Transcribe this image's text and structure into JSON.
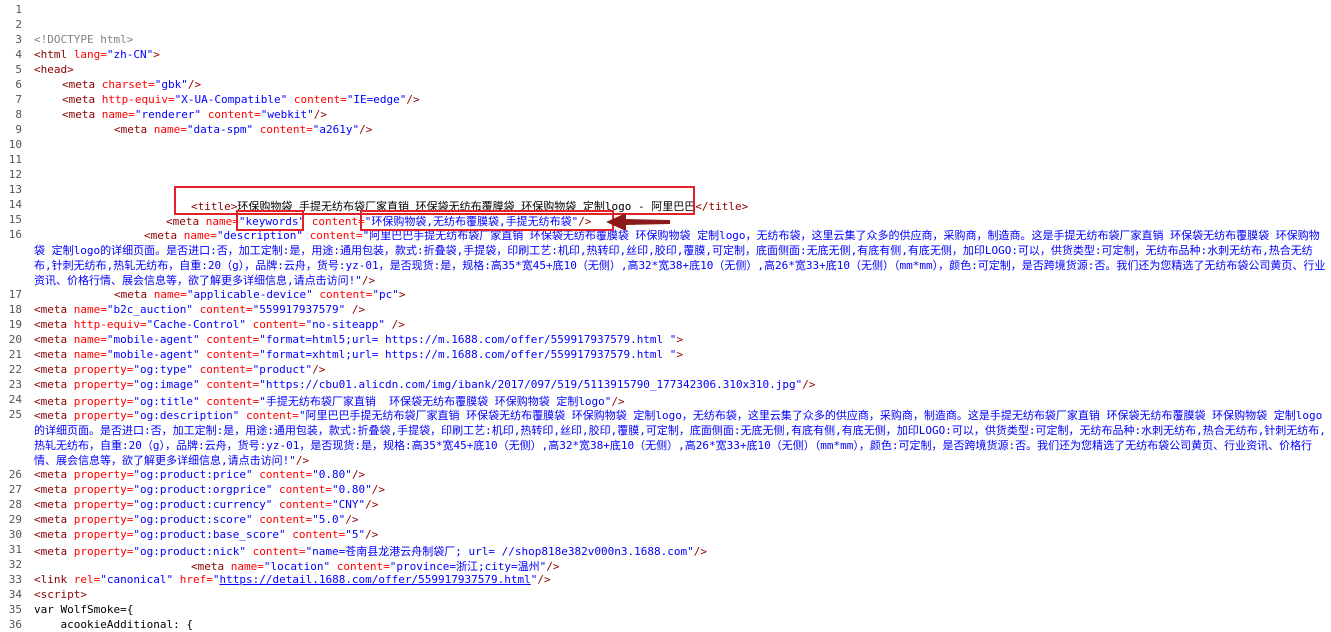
{
  "source_lines": {
    "numbers": [
      "1",
      "2",
      "3",
      "4",
      "5",
      "6",
      "7",
      "8",
      "9",
      "10",
      "11",
      "12",
      "13",
      "14",
      "15",
      "16",
      "17",
      "18",
      "19",
      "20",
      "21",
      "22",
      "23",
      "24",
      "25",
      "26",
      "27",
      "28",
      "29",
      "30",
      "31",
      "32",
      "33",
      "34",
      "35",
      "36"
    ],
    "l3": "<!DOCTYPE html>",
    "l4": [
      "<html",
      " lang=",
      "\"zh-CN\"",
      ">"
    ],
    "l5": "<head>",
    "l6": [
      "<meta",
      " charset=",
      "\"gbk\"",
      "/>"
    ],
    "l7": [
      "<meta",
      " http-equiv=",
      "\"X-UA-Compatible\"",
      " content=",
      "\"IE=edge\"",
      "/>"
    ],
    "l8": [
      "<meta",
      " name=",
      "\"renderer\"",
      " content=",
      "\"webkit\"",
      "/>"
    ],
    "l9": [
      "<meta",
      " name=",
      "\"data-spm\"",
      " content=",
      "\"a261y\"",
      "/>"
    ],
    "l14": [
      "<title>",
      "环保购物袋 手提无纺布袋厂家直销 环保袋无纺布覆膜袋 环保购物袋 定制logo",
      " - 阿里巴巴",
      "</title>"
    ],
    "l15": [
      "<meta",
      " name=",
      "\"keywords\"",
      " content=",
      "\"环保购物袋,无纺布覆膜袋,手提无纺布袋\"",
      "/>"
    ],
    "l16": [
      "<meta",
      " name=",
      "\"description\"",
      " content=",
      "\"阿里巴巴手提无纺布袋厂家直销  环保袋无纺布覆膜袋 环保购物袋 定制logo，无纺布袋，这里云集了众多的供应商，采购商，制造商。这是手提无纺布袋厂家直销  环保袋无纺布覆膜袋 环保购物袋 定制logo的详细页面。是否进口:否，加工定制:是，用途:通用包装，款式:折叠袋,手提袋，印刷工艺:机印,热转印,丝印,胶印,覆膜,可定制，底面侧面:无底无侧,有底有侧,有底无侧，加印LOGO:可以，供货类型:可定制，无纺布品种:水刺无纺布,热合无纺布,针刺无纺布,热轧无纺布，自重:20（g），品牌:云舟，货号:yz-01，是否现货:是，规格:高35*宽45+底10（无侧）,高32*宽38+底10（无侧）,高26*宽33+底10（无侧）（mm*mm），颜色:可定制，是否跨境货源:否。我们还为您精选了无纺布袋公司黄页、行业资讯、价格行情、展会信息等，欲了解更多详细信息,请点击访问!\"",
      "/>"
    ],
    "l17": [
      "<meta",
      " name=",
      "\"applicable-device\"",
      " content=",
      "\"pc\"",
      ">"
    ],
    "l18": [
      "<meta",
      " name=",
      "\"b2c_auction\"",
      " content=",
      "\"559917937579\"",
      " />"
    ],
    "l19": [
      "<meta",
      " http-equiv=",
      "\"Cache-Control\"",
      " content=",
      "\"no-siteapp\"",
      " />"
    ],
    "l20": [
      "<meta",
      " name=",
      "\"mobile-agent\"",
      " content=",
      "\"format=html5;url= https://m.1688.com/offer/559917937579.html \"",
      ">"
    ],
    "l21": [
      "<meta",
      " name=",
      "\"mobile-agent\"",
      " content=",
      "\"format=xhtml;url= https://m.1688.com/offer/559917937579.html \"",
      ">"
    ],
    "l22": [
      "<meta",
      " property=",
      "\"og:type\"",
      " content=",
      "\"product\"",
      "/>"
    ],
    "l23": [
      "<meta",
      " property=",
      "\"og:image\"",
      " content=",
      "\"https://cbu01.alicdn.com/img/ibank/2017/097/519/5113915790_177342306.310x310.jpg\"",
      "/>"
    ],
    "l24": [
      "<meta",
      " property=",
      "\"og:title\"",
      " content=",
      "\"手提无纺布袋厂家直销  环保袋无纺布覆膜袋 环保购物袋 定制logo\"",
      "/>"
    ],
    "l25": [
      "<meta",
      " property=",
      "\"og:description\"",
      " content=",
      "\"阿里巴巴手提无纺布袋厂家直销  环保袋无纺布覆膜袋 环保购物袋 定制logo，无纺布袋，这里云集了众多的供应商，采购商，制造商。这是手提无纺布袋厂家直销  环保袋无纺布覆膜袋 环保购物袋 定制logo的详细页面。是否进口:否，加工定制:是，用途:通用包装，款式:折叠袋,手提袋，印刷工艺:机印,热转印,丝印,胶印,覆膜,可定制，底面侧面:无底无侧,有底有侧,有底无侧，加印LOGO:可以，供货类型:可定制，无纺布品种:水刺无纺布,热合无纺布,针刺无纺布,热轧无纺布，自重:20（g），品牌:云舟，货号:yz-01，是否现货:是，规格:高35*宽45+底10（无侧）,高32*宽38+底10（无侧）,高26*宽33+底10（无侧）（mm*mm），颜色:可定制，是否跨境货源:否。我们还为您精选了无纺布袋公司黄页、行业资讯、价格行情、展会信息等，欲了解更多详细信息,请点击访问!\"",
      "/>"
    ],
    "l26": [
      "<meta",
      " property=",
      "\"og:product:price\"",
      " content=",
      "\"0.80\"",
      "/>"
    ],
    "l27": [
      "<meta",
      " property=",
      "\"og:product:orgprice\"",
      " content=",
      "\"0.80\"",
      "/>"
    ],
    "l28": [
      "<meta",
      " property=",
      "\"og:product:currency\"",
      " content=",
      "\"CNY\"",
      "/>"
    ],
    "l29": [
      "<meta",
      " property=",
      "\"og:product:score\"",
      " content=",
      "\"5.0\"",
      "/>"
    ],
    "l30": [
      "<meta",
      " property=",
      "\"og:product:base_score\"",
      " content=",
      "\"5\"",
      "/>"
    ],
    "l31": [
      "<meta",
      " property=",
      "\"og:product:nick\"",
      " content=",
      "\"name=苍南县龙港云舟制袋厂; url= //shop818e382v000n3.1688.com\"",
      "/>"
    ],
    "l32": [
      "<meta",
      " name=",
      "\"location\"",
      " content=",
      "\"province=浙江;city=温州\"",
      "/>"
    ],
    "l33": [
      "<link",
      " rel=",
      "\"canonical\"",
      " href=",
      "\"",
      "https://detail.1688.com/offer/559917937579.html",
      "\"",
      "/>"
    ],
    "l34": "<script>",
    "l35": "var WolfSmoke={",
    "l36": "    acookieAdditional: {"
  },
  "colors": {
    "tag": "#8b0000",
    "attr": "#ff0000",
    "value": "#0000ff",
    "comment": "#808080",
    "highlight": "#e2222a",
    "arrow": "#8b1a1a"
  }
}
